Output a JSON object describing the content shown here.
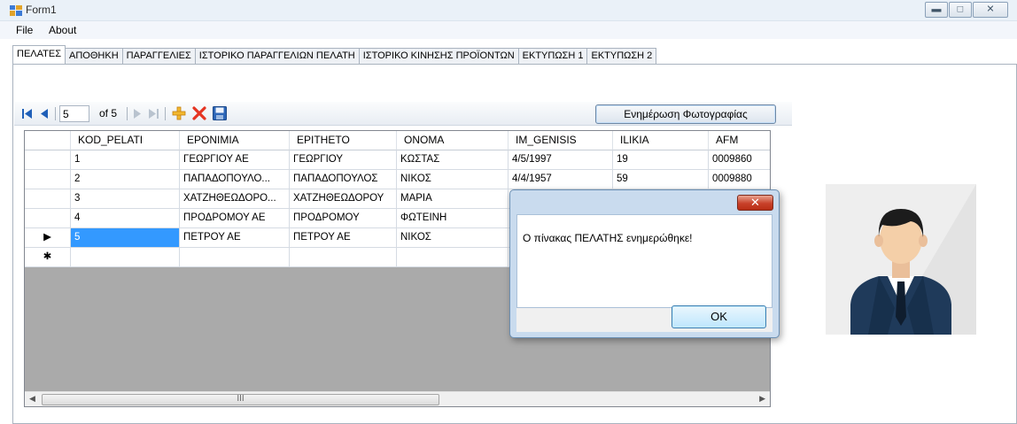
{
  "window": {
    "title": "Form1"
  },
  "menu": [
    "File",
    "About"
  ],
  "tabs": [
    "ΠΕΛΑΤΕΣ",
    "ΑΠΟΘΗΚΗ",
    "ΠΑΡΑΓΓΕΛΙΕΣ",
    "ΙΣΤΟΡΙΚΟ ΠΑΡΑΓΓΕΛΙΩΝ ΠΕΛΑΤΗ",
    "ΙΣΤΟΡΙΚΟ ΚΙΝΗΣΗΣ ΠΡΟΪΟΝΤΩΝ",
    "ΕΚΤΥΠΩΣΗ 1",
    "ΕΚΤΥΠΩΣΗ 2"
  ],
  "navigator": {
    "position": "5",
    "count_label": "of 5",
    "update_photo_label": "Ενημέρωση Φωτογραφίας"
  },
  "grid": {
    "columns": [
      "KOD_PELATI",
      "EPONIMIA",
      "EPITHETO",
      "ONOMA",
      "IM_GENISIS",
      "ILIKIA",
      "AFM"
    ],
    "rows": [
      {
        "marker": "",
        "cells": [
          "1",
          "ΓΕΩΡΓΙΟΥ ΑΕ",
          "ΓΕΩΡΓΙΟΥ",
          "ΚΩΣΤΑΣ",
          "4/5/1997",
          "19",
          "0009860"
        ]
      },
      {
        "marker": "",
        "cells": [
          "2",
          "ΠΑΠΑΔΟΠΟΥΛΟ...",
          "ΠΑΠΑΔΟΠΟΥΛΟΣ",
          "ΝΙΚΟΣ",
          "4/4/1957",
          "59",
          "0009880"
        ]
      },
      {
        "marker": "",
        "cells": [
          "3",
          "ΧΑΤΖΗΘΕΩΔΟΡΟ...",
          "ΧΑΤΖΗΘΕΩΔΟΡΟΥ",
          "ΜΑΡΙΑ",
          "",
          "",
          ""
        ]
      },
      {
        "marker": "",
        "cells": [
          "4",
          "ΠΡΟΔΡΟΜΟΥ ΑΕ",
          "ΠΡΟΔΡΟΜΟΥ",
          "ΦΩΤΕΙΝΗ",
          "",
          "",
          ""
        ]
      },
      {
        "marker": "▶",
        "cells": [
          "5",
          "ΠΕΤΡΟΥ ΑΕ",
          "ΠΕΤΡΟΥ ΑΕ",
          "ΝΙΚΟΣ",
          "",
          "",
          ""
        ]
      },
      {
        "marker": "✱",
        "cells": [
          "",
          "",
          "",
          "",
          "",
          "",
          ""
        ]
      }
    ]
  },
  "scrollbar": {
    "grip": "III"
  },
  "dialog": {
    "message": "Ο πίνακας ΠΕΛΑΤΗΣ ενημερώθηκε!",
    "ok_label": "OK",
    "close_glyph": "✕"
  },
  "colors": {
    "selection": "#3399ff",
    "grid_background": "#aaaaaa",
    "dialog_frame": "#c9dbee",
    "close_red": "#c8412a"
  }
}
